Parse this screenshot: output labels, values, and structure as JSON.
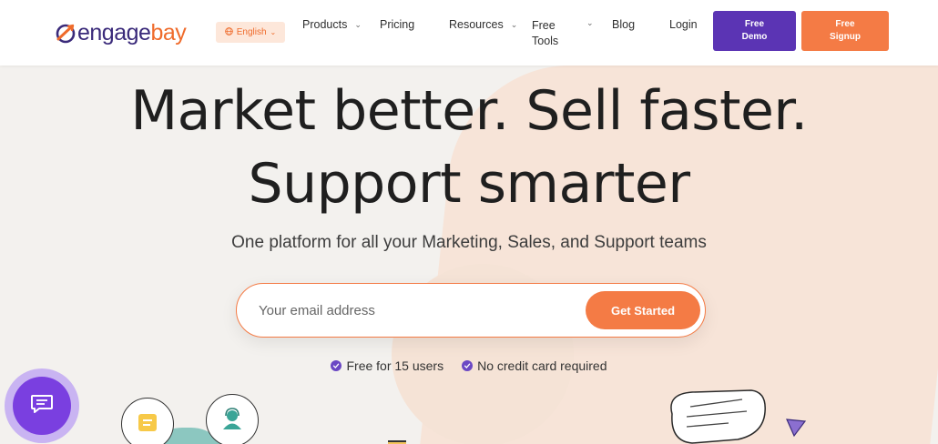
{
  "header": {
    "logo": {
      "part1": "engage",
      "part2": "bay"
    },
    "language": {
      "label": "English"
    },
    "nav": [
      {
        "label": "Products",
        "dropdown": true
      },
      {
        "label": "Pricing",
        "dropdown": false
      },
      {
        "label": "Resources",
        "dropdown": true
      },
      {
        "label": "Free Tools",
        "dropdown": true
      },
      {
        "label": "Blog",
        "dropdown": false
      },
      {
        "label": "Login",
        "dropdown": false
      }
    ],
    "demo_button": {
      "line1": "Free",
      "line2": "Demo"
    },
    "signup_button": {
      "line1": "Free",
      "line2": "Signup"
    }
  },
  "hero": {
    "title_line1": "Market better. Sell faster.",
    "title_line2": "Support smarter",
    "subtitle": "One platform for all your Marketing, Sales, and Support teams",
    "email_placeholder": "Your email address",
    "cta_label": "Get Started",
    "benefits": [
      "Free for 15 users",
      "No credit card required"
    ]
  },
  "colors": {
    "brand_purple": "#5b34b4",
    "brand_orange": "#f47b45",
    "logo_dark": "#3a2a7a"
  },
  "icons": [
    "globe-icon",
    "chevron-down-icon",
    "check-circle-icon",
    "chat-icon",
    "note-icon",
    "support-agent-icon"
  ]
}
